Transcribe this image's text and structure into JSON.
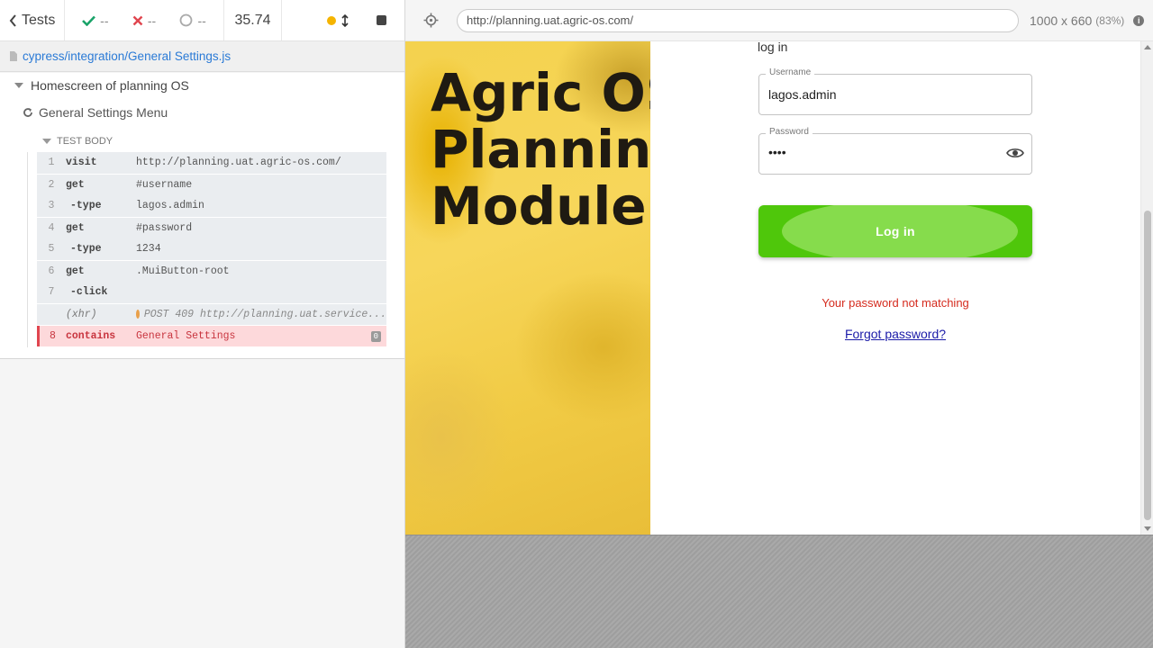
{
  "reporter": {
    "tests_label": "Tests",
    "passed": "--",
    "failed": "--",
    "pending": "--",
    "duration": "35.74",
    "spec_path": "cypress/integration/General Settings.js",
    "suite_title": "Homescreen of planning OS",
    "test_title": "General Settings Menu",
    "test_body_label": "TEST BODY",
    "commands": [
      {
        "num": "1",
        "name": "visit",
        "msg": "http://planning.uat.agric-os.com/"
      },
      {
        "num": "2",
        "name": "get",
        "msg": "#username"
      },
      {
        "num": "3",
        "name": "-type",
        "msg": "lagos.admin"
      },
      {
        "num": "4",
        "name": "get",
        "msg": "#password"
      },
      {
        "num": "5",
        "name": "-type",
        "msg": "1234"
      },
      {
        "num": "6",
        "name": "get",
        "msg": ".MuiButton-root"
      },
      {
        "num": "7",
        "name": "-click",
        "msg": ""
      },
      {
        "num": "",
        "name": "(xhr)",
        "msg": "POST 409 http://planning.uat.service..."
      },
      {
        "num": "8",
        "name": "contains",
        "msg": "General Settings",
        "badge": "0"
      }
    ]
  },
  "preview": {
    "url": "http://planning.uat.agric-os.com/",
    "viewport": "1000 x 660",
    "scale": "(83%)",
    "hero_title": "Agric OS\nPlanning\nModule",
    "login": {
      "heading": "log in",
      "username_label": "Username",
      "username_value": "lagos.admin",
      "password_label": "Password",
      "password_value": "••••",
      "button_label": "Log in",
      "error": "Your password not matching",
      "forgot": "Forgot password?"
    },
    "colors": {
      "button_green": "#4fc70b",
      "error_red": "#d52b1e",
      "link_blue": "#1a1aa8",
      "failed_row_bg": "#fdd9db"
    }
  }
}
